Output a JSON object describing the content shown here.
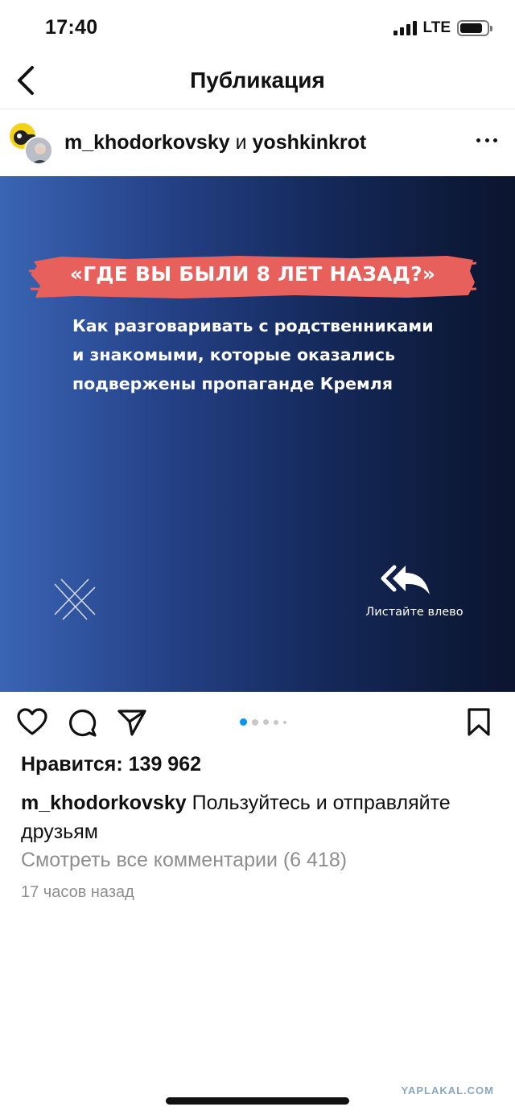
{
  "status_bar": {
    "time": "17:40",
    "network": "LTE",
    "battery_level": 0.85
  },
  "header": {
    "title": "Публикация",
    "back_icon": "chevron-left-icon"
  },
  "post": {
    "author_primary": "m_khodorkovsky",
    "conjunction": "и",
    "author_secondary": "yoshkinkrot",
    "more_icon": "more-horizontal-icon",
    "image": {
      "headline": "«ГДЕ ВЫ БЫЛИ 8 ЛЕТ НАЗАД?»",
      "subtitle_lines": [
        "Как разговаривать с родственниками",
        "и знакомыми, которые оказались",
        "подвержены пропаганде Кремля"
      ],
      "swipe_label": "Листайте влево",
      "colors": {
        "headline_bg": "#e8605c",
        "gradient_start": "#3a65b4",
        "gradient_end": "#0b1530"
      }
    },
    "carousel": {
      "count": 5,
      "active_index": 0,
      "active_color": "#0095f6"
    },
    "likes": "Нравится: 139 962",
    "caption": {
      "user": "m_khodorkovsky",
      "text": "Пользуйтесь и отправляйте друзьям"
    },
    "comments_link": "Смотреть все комментарии (6 418)",
    "time_ago": "17 часов назад"
  },
  "watermark": "YAPLAKAL.COM"
}
